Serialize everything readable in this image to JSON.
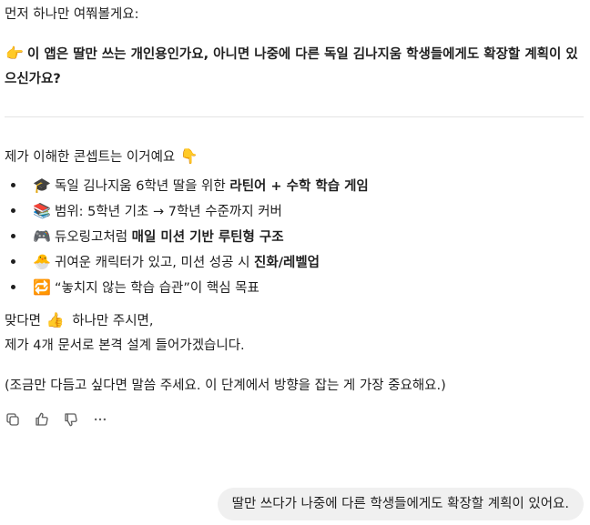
{
  "assistant": {
    "q_intro": "먼저 하나만 여쭤볼게요:",
    "q_icon": "👉",
    "q_line1": "이 앱은 딸만 쓰는 개인용인가요, 아니면 나중에 다른 독일 김나지움 학생들에게도 확장할 계획이 있",
    "q_line2": "으신가요?",
    "concept_intro": "제가 이해한 콘셉트는 이거예요",
    "concept_intro_icon": "👇",
    "bullets": [
      {
        "icon": "🎓",
        "text": "독일 김나지움 6학년 딸을 위한 ",
        "bold": "라틴어 + 수학 학습 게임",
        "after": ""
      },
      {
        "icon": "📚",
        "text": "범위: 5학년 기초 → 7학년 수준까지 커버",
        "bold": "",
        "after": ""
      },
      {
        "icon": "🎮",
        "text": "듀오링고처럼 ",
        "bold": "매일 미션 기반 루틴형 구조",
        "after": ""
      },
      {
        "icon": "🐣",
        "text": "귀여운 캐릭터가 있고, 미션 성공 시 ",
        "bold": "진화/레벨업",
        "after": ""
      },
      {
        "icon": "🔁",
        "text": "“놓치지 않는 학습 습관”이 핵심 목표",
        "bold": "",
        "after": ""
      }
    ],
    "closing_a": "맞다면",
    "closing_icon": "👍",
    "closing_b": "하나만 주시면,",
    "closing2": "제가 4개 문서로 본격 설계 들어가겠습니다.",
    "note": "(조금만 다듬고 싶다면 말씀 주세요. 이 단계에서 방향을 잡는 게 가장 중요해요.)"
  },
  "user": {
    "message": "딸만 쓰다가 나중에 다른 학생들에게도 확장할 계획이 있어요."
  },
  "actions": {
    "copy": "copy-icon",
    "thumbs_up": "thumbs-up-icon",
    "thumbs_down": "thumbs-down-icon",
    "more": "more-icon"
  }
}
